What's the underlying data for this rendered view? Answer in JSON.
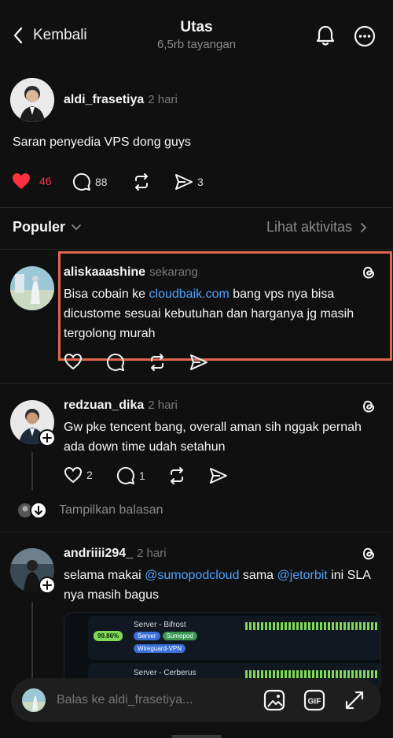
{
  "header": {
    "back_label": "Kembali",
    "title": "Utas",
    "subtitle": "6,5rb tayangan"
  },
  "post": {
    "username": "aldi_frasetiya",
    "time": "2 hari",
    "text": "Saran penyedia VPS dong guys",
    "likes": "46",
    "comments": "88",
    "shares": "3"
  },
  "sort": {
    "label": "Populer",
    "activity_label": "Lihat aktivitas"
  },
  "replies": [
    {
      "username": "aliskaaashine",
      "time": "sekarang",
      "text_before": "Bisa cobain ke ",
      "link": "cloudbaik.com",
      "text_after": " bang vps nya bisa dicustome sesuai kebutuhan dan harganya jg masih tergolong murah"
    },
    {
      "username": "redzuan_dika",
      "time": "2 hari",
      "text": "Gw pke tencent bang, overall aman sih nggak pernah ada down time udah setahun",
      "likes": "2",
      "comments": "1",
      "show_replies": "Tampilkan balasan"
    },
    {
      "username": "andriiii294_",
      "time": "2 hari",
      "text_1": "selama makai ",
      "mention_1": "@sumopodcloud",
      "text_2": " sama ",
      "mention_2": "@jetorbit",
      "text_3": " ini SLA nya masih bagus"
    }
  ],
  "embed": {
    "server1": "Server - Bifrost",
    "uptime1": "99.86%",
    "tags1": [
      "Server",
      "Sumopod",
      "Wireguard-VPN"
    ],
    "server2": "Server - Cerberus"
  },
  "composer": {
    "placeholder": "Balas ke aldi_frasetiya..."
  },
  "colors": {
    "accent_red": "#ff3040",
    "link_blue": "#4da3ff",
    "highlight_box": "#e0664f",
    "uptime_green": "#7ed957"
  }
}
